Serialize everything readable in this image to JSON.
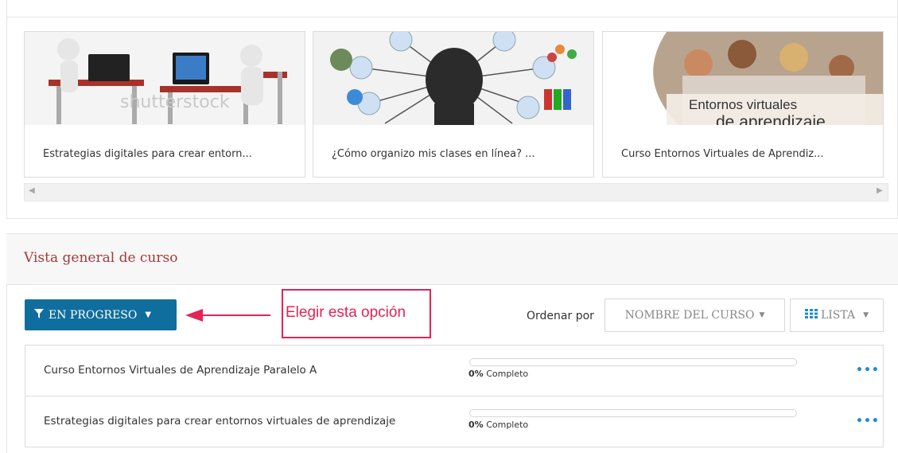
{
  "recent": {
    "cards": [
      {
        "title": "Estrategias digitales para crear entorn..."
      },
      {
        "title": "¿Cómo organizo mis clases en línea? ..."
      },
      {
        "title": "Curso Entornos Virtuales de Aprendiz...",
        "image_text_1": "Entornos virtuales",
        "image_text_2": "de aprendizaje"
      }
    ],
    "watermark": "shutterstock"
  },
  "overview": {
    "title": "Vista general de curso",
    "filter_label": "EN PROGRESO",
    "annotation": "Elegir esta opción",
    "sort_prefix": "Ordenar por",
    "sort_label": "NOMBRE DEL CURSO",
    "view_label": "LISTA",
    "courses": [
      {
        "name": "Curso Entornos Virtuales de Aprendizaje Paralelo A",
        "progress": 0,
        "percent_text": "0%",
        "status": "Completo"
      },
      {
        "name": "Estrategias digitales para crear entornos virtuales de aprendizaje",
        "progress": 0,
        "percent_text": "0%",
        "status": "Completo"
      }
    ],
    "more_label": "•••"
  },
  "colors": {
    "accent": "#0f6e9d",
    "section_title": "#a33a3a",
    "annotation": "#e32455"
  },
  "icons": [
    "filter-icon",
    "caret-down-icon",
    "grid-icon",
    "ellipsis-icon",
    "scroll-left-icon",
    "scroll-right-icon"
  ]
}
